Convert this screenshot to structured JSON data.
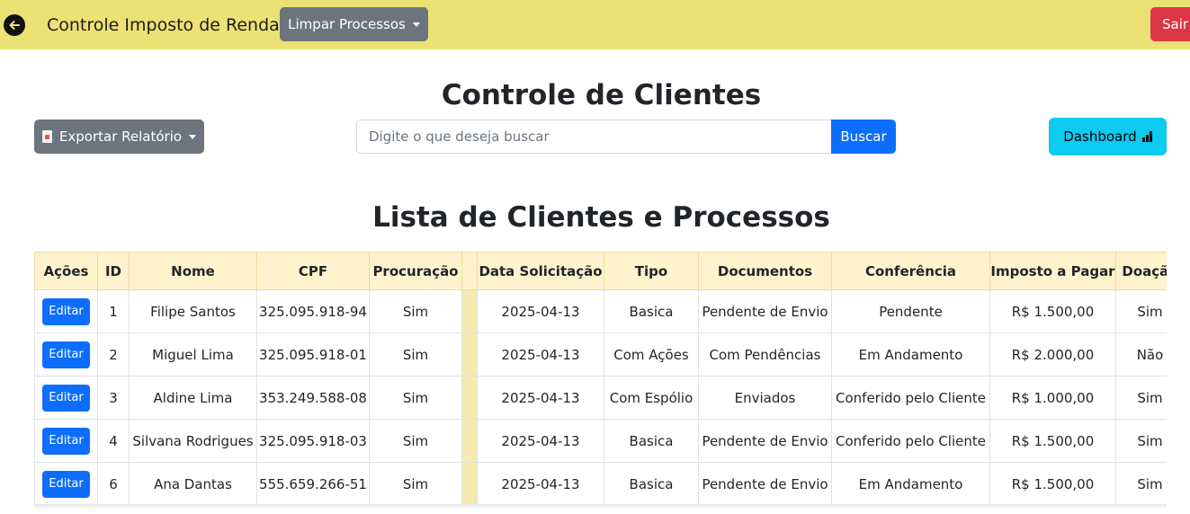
{
  "navbar": {
    "brand": "Controle Imposto de Renda",
    "limpar_label": "Limpar Processos",
    "sair_label": "Sair"
  },
  "page_title": "Controle de Clientes",
  "toolbar": {
    "export_label": "Exportar Relatório",
    "search_placeholder": "Digite o que deseja buscar",
    "search_value": "",
    "search_button": "Buscar",
    "dashboard_label": "Dashboard"
  },
  "section_title": "Lista de Clientes e Processos",
  "table": {
    "headers": [
      "Ações",
      "ID",
      "Nome",
      "CPF",
      "Procuração",
      "",
      "Data Solicitação",
      "Tipo",
      "Documentos",
      "Conferência",
      "Imposto a Pagar",
      "Doação"
    ],
    "edit_label": "Editar",
    "rows": [
      {
        "id": "1",
        "nome": "Filipe Santos",
        "cpf": "325.095.918-94",
        "procuracao": "Sim",
        "data": "2025-04-13",
        "tipo": "Basica",
        "documentos": "Pendente de Envio",
        "conferencia": "Pendente",
        "imposto": "R$ 1.500,00",
        "doacao": "Sim"
      },
      {
        "id": "2",
        "nome": "Miguel Lima",
        "cpf": "325.095.918-01",
        "procuracao": "Sim",
        "data": "2025-04-13",
        "tipo": "Com Ações",
        "documentos": "Com Pendências",
        "conferencia": "Em Andamento",
        "imposto": "R$ 2.000,00",
        "doacao": "Não"
      },
      {
        "id": "3",
        "nome": "Aldine Lima",
        "cpf": "353.249.588-08",
        "procuracao": "Sim",
        "data": "2025-04-13",
        "tipo": "Com Espólio",
        "documentos": "Enviados",
        "conferencia": "Conferido pelo Cliente",
        "imposto": "R$ 1.000,00",
        "doacao": "Sim"
      },
      {
        "id": "4",
        "nome": "Silvana Rodrigues",
        "cpf": "325.095.918-03",
        "procuracao": "Sim",
        "data": "2025-04-13",
        "tipo": "Basica",
        "documentos": "Pendente de Envio",
        "conferencia": "Conferido pelo Cliente",
        "imposto": "R$ 1.500,00",
        "doacao": "Sim"
      },
      {
        "id": "6",
        "nome": "Ana Dantas",
        "cpf": "555.659.266-51",
        "procuracao": "Sim",
        "data": "2025-04-13",
        "tipo": "Basica",
        "documentos": "Pendente de Envio",
        "conferencia": "Em Andamento",
        "imposto": "R$ 1.500,00",
        "doacao": "Sim"
      }
    ]
  },
  "colors": {
    "navbar_bg": "#ece174",
    "primary": "#0d6efd",
    "secondary": "#6c757d",
    "danger": "#dc3545",
    "info": "#0dcaf0",
    "table_header_bg": "#fff3cd"
  },
  "icons": {
    "back": "arrow-left-circle-icon",
    "export": "document-icon",
    "dashboard": "bar-chart-icon"
  }
}
